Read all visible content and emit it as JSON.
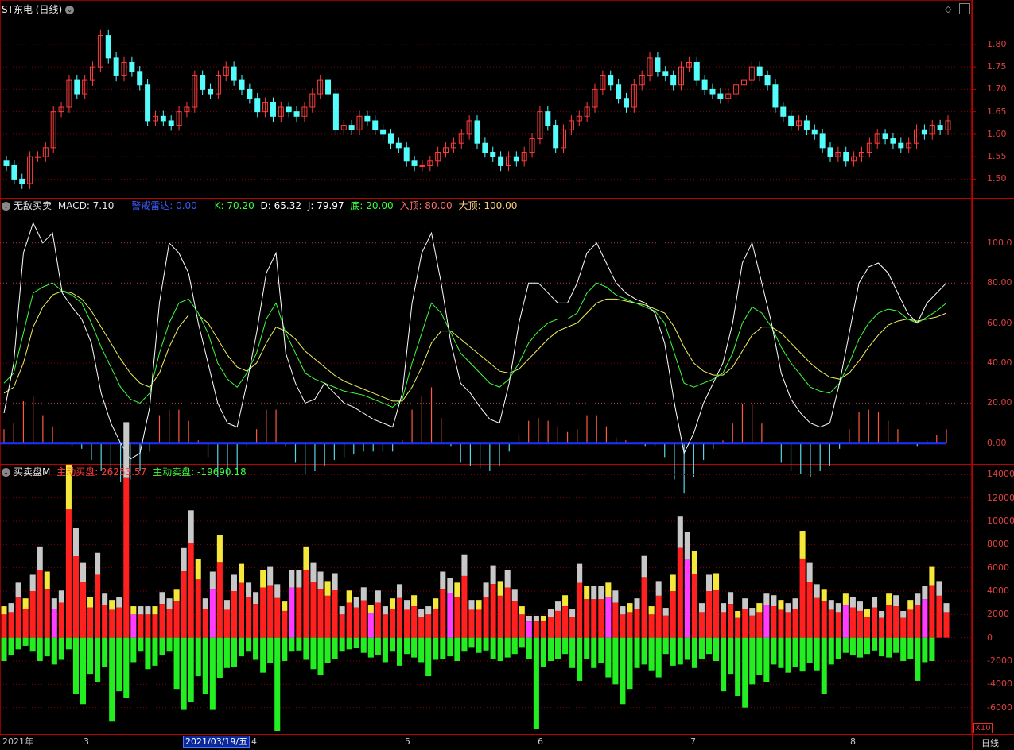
{
  "main": {
    "title": "ST东电 (日线)",
    "high_label": "1.84",
    "low_label": "1.47",
    "yticks": [
      "1.80",
      "1.75",
      "1.70",
      "1.65",
      "1.60",
      "1.55",
      "1.50"
    ]
  },
  "ind1": {
    "name": "无敌买卖",
    "macd": "MACD: 7.10",
    "radar": "警戒雷达: 0.00",
    "k": "K: 70.20",
    "d": "D: 65.32",
    "j": "J: 79.97",
    "bottom": "底: 20.00",
    "enter_top": "入顶: 80.00",
    "big_top": "大顶: 100.00",
    "yticks": [
      "100.0",
      "80.00",
      "60.00",
      "40.00",
      "20.00",
      "0.00"
    ]
  },
  "ind2": {
    "name": "买卖盘M",
    "buy": "主动买盘: 26253.57",
    "sell": "主动卖盘: -19690.18",
    "yticks": [
      "14000",
      "12000",
      "10000",
      "8000",
      "6000",
      "4000",
      "2000",
      "0",
      "-2000",
      "-4000",
      "-6000"
    ]
  },
  "xaxis": {
    "labels": [
      "2021年",
      "3",
      "4",
      "5",
      "6",
      "7",
      "8"
    ],
    "cursor_date": "2021/03/19/五",
    "zoom": "X10",
    "period": "日线"
  },
  "colors": {
    "up": "#ff3c3c",
    "down": "#54fcfc",
    "bg": "#000000",
    "grid": "#8b0000"
  },
  "chart_data": [
    {
      "type": "candlestick",
      "title": "ST东电 (日线)",
      "ylim": [
        1.46,
        1.86
      ],
      "high": 1.84,
      "low": 1.47,
      "close_series": [
        1.53,
        1.5,
        1.49,
        1.55,
        1.55,
        1.57,
        1.65,
        1.66,
        1.72,
        1.69,
        1.72,
        1.75,
        1.82,
        1.77,
        1.73,
        1.76,
        1.74,
        1.71,
        1.63,
        1.64,
        1.63,
        1.62,
        1.65,
        1.66,
        1.73,
        1.7,
        1.69,
        1.73,
        1.75,
        1.72,
        1.7,
        1.68,
        1.65,
        1.67,
        1.64,
        1.66,
        1.65,
        1.64,
        1.66,
        1.69,
        1.72,
        1.69,
        1.61,
        1.62,
        1.61,
        1.64,
        1.63,
        1.61,
        1.6,
        1.58,
        1.57,
        1.54,
        1.53,
        1.53,
        1.54,
        1.56,
        1.57,
        1.58,
        1.6,
        1.63,
        1.58,
        1.56,
        1.55,
        1.53,
        1.55,
        1.54,
        1.56,
        1.59,
        1.65,
        1.62,
        1.57,
        1.61,
        1.63,
        1.64,
        1.66,
        1.7,
        1.73,
        1.71,
        1.68,
        1.66,
        1.71,
        1.73,
        1.77,
        1.74,
        1.73,
        1.71,
        1.75,
        1.76,
        1.72,
        1.7,
        1.69,
        1.68,
        1.69,
        1.71,
        1.72,
        1.75,
        1.73,
        1.71,
        1.66,
        1.64,
        1.62,
        1.63,
        1.61,
        1.6,
        1.57,
        1.55,
        1.56,
        1.54,
        1.55,
        1.56,
        1.58,
        1.6,
        1.59,
        1.58,
        1.57,
        1.58,
        1.61,
        1.6,
        1.62,
        1.61,
        1.63
      ]
    },
    {
      "type": "line",
      "title": "无敌买卖",
      "ylim": [
        -10,
        115
      ],
      "series": [
        {
          "name": "K",
          "values": [
            30,
            35,
            55,
            75,
            78,
            80,
            76,
            74,
            70,
            60,
            48,
            38,
            28,
            22,
            20,
            25,
            45,
            60,
            70,
            72,
            65,
            55,
            40,
            32,
            28,
            35,
            45,
            62,
            70,
            55,
            45,
            35,
            32,
            30,
            28,
            26,
            25,
            24,
            22,
            20,
            18,
            22,
            40,
            55,
            70,
            65,
            55,
            45,
            40,
            35,
            30,
            28,
            32,
            40,
            50,
            56,
            60,
            62,
            62,
            65,
            75,
            80,
            78,
            74,
            72,
            70,
            68,
            66,
            60,
            45,
            30,
            28,
            30,
            32,
            35,
            45,
            60,
            68,
            65,
            58,
            48,
            40,
            34,
            28,
            26,
            25,
            30,
            40,
            52,
            60,
            65,
            67,
            66,
            62,
            60,
            63,
            66,
            70
          ]
        },
        {
          "name": "D",
          "values": [
            25,
            28,
            40,
            58,
            68,
            74,
            76,
            75,
            72,
            66,
            58,
            50,
            42,
            35,
            30,
            28,
            35,
            48,
            58,
            64,
            64,
            60,
            52,
            44,
            38,
            36,
            40,
            50,
            58,
            56,
            52,
            46,
            42,
            38,
            34,
            31,
            29,
            27,
            25,
            23,
            21,
            21,
            28,
            38,
            50,
            56,
            56,
            52,
            48,
            44,
            40,
            36,
            35,
            37,
            42,
            47,
            52,
            56,
            58,
            60,
            65,
            70,
            72,
            72,
            71,
            70,
            69,
            67,
            65,
            58,
            48,
            40,
            36,
            34,
            34,
            38,
            46,
            54,
            58,
            58,
            55,
            50,
            45,
            40,
            36,
            33,
            32,
            35,
            41,
            48,
            54,
            59,
            61,
            62,
            61,
            62,
            63,
            65
          ]
        },
        {
          "name": "J",
          "values": [
            15,
            40,
            95,
            110,
            100,
            105,
            75,
            68,
            62,
            50,
            25,
            10,
            0,
            -8,
            -5,
            18,
            70,
            100,
            95,
            85,
            60,
            40,
            20,
            10,
            8,
            30,
            55,
            85,
            95,
            45,
            30,
            20,
            22,
            30,
            25,
            20,
            18,
            15,
            12,
            10,
            8,
            25,
            70,
            95,
            105,
            80,
            50,
            30,
            25,
            18,
            12,
            10,
            30,
            60,
            80,
            80,
            75,
            70,
            70,
            80,
            95,
            100,
            90,
            80,
            75,
            72,
            70,
            65,
            50,
            20,
            -5,
            5,
            20,
            30,
            40,
            60,
            90,
            100,
            80,
            60,
            35,
            22,
            15,
            10,
            8,
            10,
            30,
            55,
            80,
            88,
            90,
            85,
            75,
            65,
            60,
            70,
            75,
            80
          ]
        }
      ],
      "y_ref_lines": [
        0,
        20,
        80,
        100
      ]
    },
    {
      "type": "bar",
      "title": "买卖盘M",
      "ylim": [
        -8000,
        14500
      ],
      "series": [
        {
          "name": "主动买盘",
          "values": [
            2000,
            2200,
            3500,
            2500,
            4000,
            5800,
            4200,
            2500,
            3000,
            11000,
            7000,
            4800,
            2600,
            5400,
            2800,
            2400,
            2600,
            13700,
            2000,
            2000,
            2000,
            2000,
            2900,
            2500,
            3100,
            5700,
            8100,
            5000,
            2500,
            4200,
            6500,
            2400,
            4000,
            4700,
            3500,
            2900,
            4300,
            4500,
            3400,
            2300,
            4300,
            4300,
            5800,
            4800,
            4200,
            3600,
            4100,
            2000,
            3000,
            2600,
            3200,
            2100,
            3000,
            2000,
            2500,
            3400,
            2400,
            2700,
            1800,
            2000,
            2500,
            4200,
            3800,
            3500,
            5300,
            2400,
            2400,
            3500,
            4600,
            3600,
            4300,
            3100,
            2000,
            1400,
            1400,
            1400,
            1800,
            2300,
            2700,
            1800,
            4700,
            3300,
            3300,
            3300,
            3500,
            3000,
            2000,
            2200,
            2500,
            5200,
            2000,
            3600,
            1900,
            4000,
            7700,
            6700,
            5500,
            2200,
            4000,
            4100,
            2200,
            2900,
            1700,
            2500,
            1900,
            2200,
            2800,
            2700,
            2400,
            2200,
            2500,
            6800,
            4800,
            3400,
            3100,
            2400,
            2200,
            2800,
            2600,
            2300,
            1800,
            2600,
            1700,
            2800,
            2700,
            1700,
            2400,
            2800,
            3300,
            4500,
            3600,
            2200
          ]
        },
        {
          "name": "主动卖盘",
          "values": [
            -2000,
            -1500,
            -1000,
            -700,
            -1200,
            -2000,
            -1600,
            -2300,
            -1900,
            -1000,
            -4800,
            -5700,
            -3100,
            -3800,
            -2500,
            -7200,
            -4600,
            -5200,
            -2100,
            -1200,
            -2700,
            -2400,
            -1500,
            -1200,
            -4400,
            -6200,
            -5500,
            -3300,
            -4800,
            -6200,
            -3500,
            -2600,
            -2500,
            -1600,
            -1200,
            -1900,
            -3000,
            -2200,
            -8000,
            -2000,
            -1200,
            -1100,
            -1900,
            -2700,
            -3200,
            -2200,
            -1800,
            -1200,
            -1000,
            -900,
            -1300,
            -1700,
            -1500,
            -2100,
            -1200,
            -2400,
            -1400,
            -1700,
            -2100,
            -3300,
            -1900,
            -1800,
            -1600,
            -2000,
            -1200,
            -800,
            -1300,
            -1100,
            -1800,
            -2000,
            -1700,
            -1400,
            -800,
            -1800,
            -7800,
            -2500,
            -2000,
            -1800,
            -1400,
            -2600,
            -3700,
            -1800,
            -2600,
            -2200,
            -3400,
            -4000,
            -5700,
            -4400,
            -2600,
            -2300,
            -2800,
            -3400,
            -1400,
            -2400,
            -2300,
            -1900,
            -2600,
            -1800,
            -1400,
            -2000,
            -4600,
            -3100,
            -5000,
            -6000,
            -4000,
            -3200,
            -3800,
            -2300,
            -2600,
            -3000,
            -2500,
            -2900,
            -2200,
            -2800,
            -4800,
            -2300,
            -1800,
            -1300,
            -1500,
            -1700,
            -1400,
            -1100,
            -1600,
            -1700,
            -1300,
            -2000,
            -1800,
            -3700,
            -2100,
            -2000
          ]
        }
      ]
    }
  ]
}
